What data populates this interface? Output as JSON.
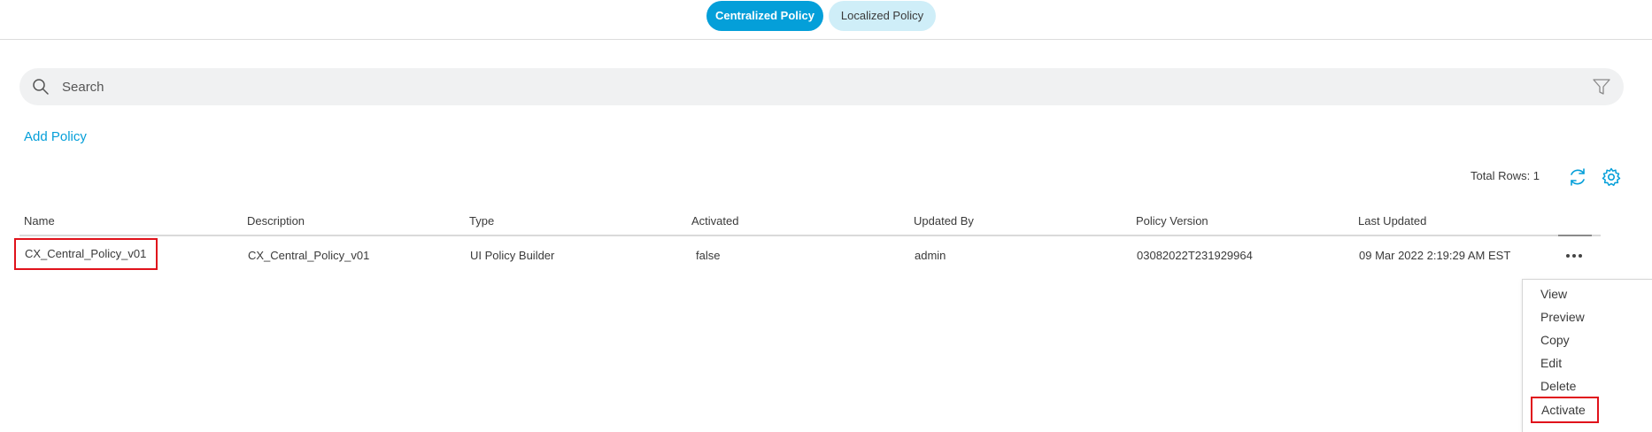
{
  "tabs": {
    "centralized": "Centralized Policy",
    "localized": "Localized Policy"
  },
  "search": {
    "placeholder": "Search"
  },
  "actions": {
    "add_policy": "Add Policy",
    "total_rows": "Total Rows: 1"
  },
  "table": {
    "headers": {
      "name": "Name",
      "description": "Description",
      "type": "Type",
      "activated": "Activated",
      "updated_by": "Updated By",
      "policy_version": "Policy Version",
      "last_updated": "Last Updated"
    },
    "rows": [
      {
        "name": "CX_Central_Policy_v01",
        "description": "CX_Central_Policy_v01",
        "type": "UI Policy Builder",
        "activated": "false",
        "updated_by": "admin",
        "policy_version": "03082022T231929964",
        "last_updated": "09 Mar 2022 2:19:29 AM EST"
      }
    ]
  },
  "menu": {
    "items": [
      "View",
      "Preview",
      "Copy",
      "Edit",
      "Delete",
      "Activate"
    ]
  },
  "colors": {
    "accent": "#049fd9",
    "highlight": "#e0121b"
  },
  "icons": {
    "search": "search-icon",
    "filter": "filter-icon",
    "refresh": "refresh-icon",
    "settings": "gear-icon",
    "more": "more-horizontal-icon"
  }
}
